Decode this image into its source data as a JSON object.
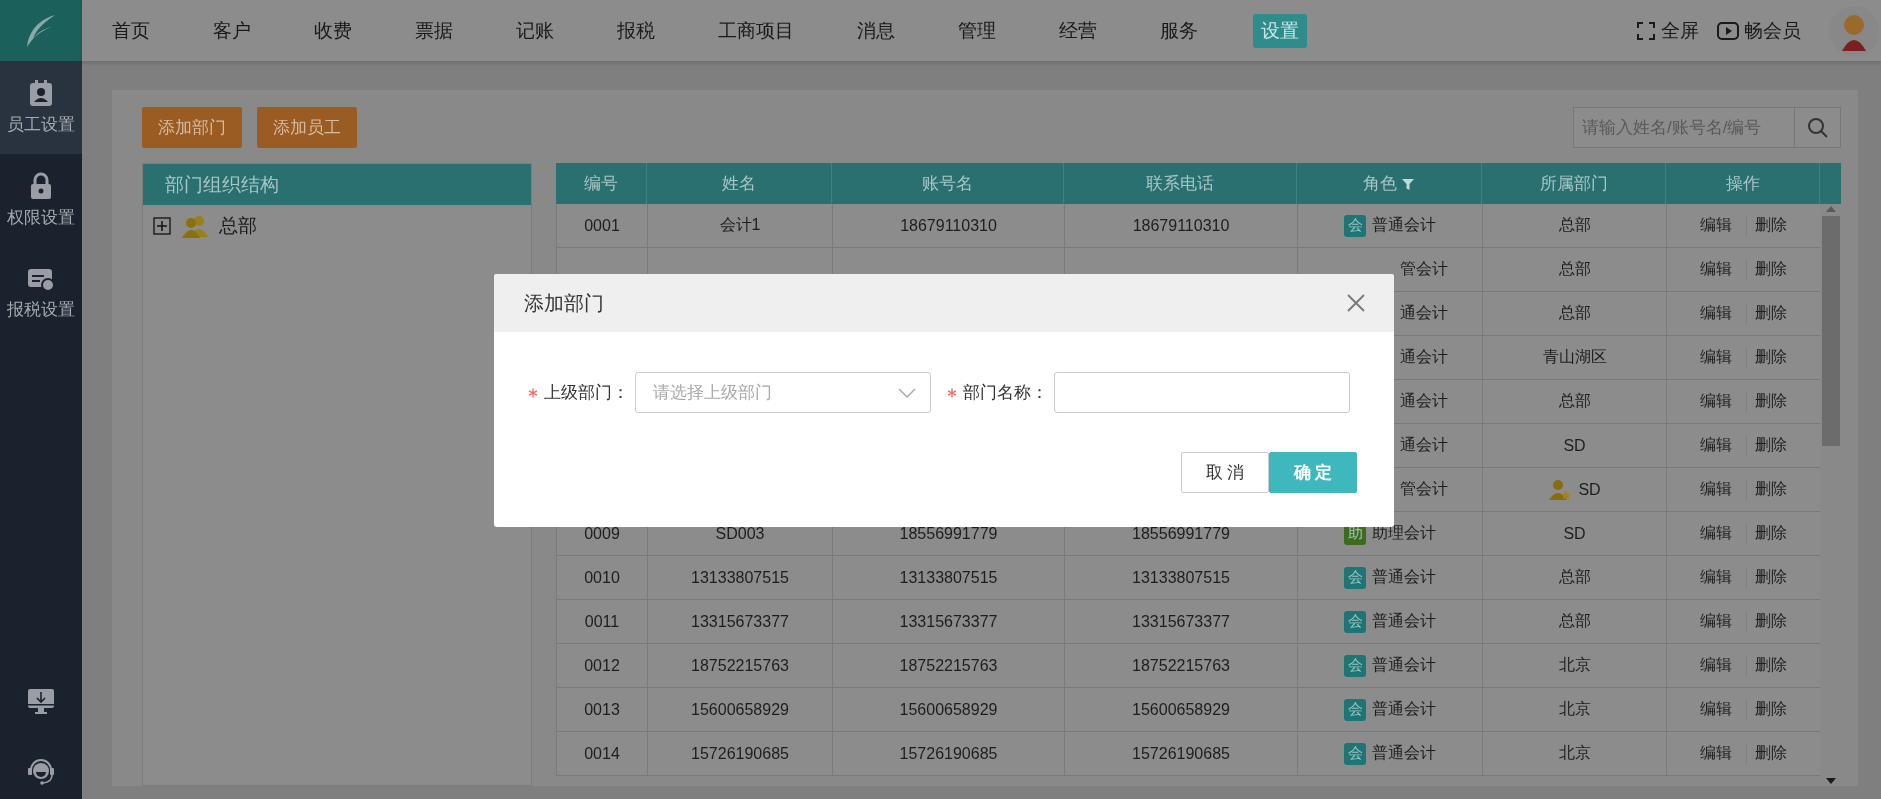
{
  "nav": [
    {
      "label": "首页",
      "selected": false
    },
    {
      "label": "客户",
      "selected": false
    },
    {
      "label": "收费",
      "selected": false
    },
    {
      "label": "票据",
      "selected": false
    },
    {
      "label": "记账",
      "selected": false
    },
    {
      "label": "报税",
      "selected": false
    },
    {
      "label": "工商项目",
      "selected": false
    },
    {
      "label": "消息",
      "selected": false
    },
    {
      "label": "管理",
      "selected": false
    },
    {
      "label": "经营",
      "selected": false
    },
    {
      "label": "服务",
      "selected": false
    },
    {
      "label": "设置",
      "selected": true
    }
  ],
  "top_actions": [
    {
      "label": "全屏",
      "kind": "fullscreen"
    },
    {
      "label": "畅会员",
      "kind": "member"
    }
  ],
  "sidebar": {
    "items": [
      {
        "label": "员工设置",
        "kind": "staff",
        "selected": true
      },
      {
        "label": "权限设置",
        "kind": "lock",
        "selected": false
      },
      {
        "label": "报税设置",
        "kind": "tax",
        "selected": false
      }
    ]
  },
  "toolbar": {
    "buttons": [
      "添加部门",
      "添加员工"
    ],
    "search": {
      "placeholder": "请输入姓名/账号名/编号"
    }
  },
  "tree": {
    "title": "部门组织结构",
    "nodes": [
      {
        "label": "总部",
        "expanded": false
      }
    ]
  },
  "table": {
    "columns": [
      {
        "label": "编号",
        "filter": false
      },
      {
        "label": "姓名",
        "filter": false
      },
      {
        "label": "账号名",
        "filter": false
      },
      {
        "label": "联系电话",
        "filter": false
      },
      {
        "label": "角色",
        "filter": true
      },
      {
        "label": "所属部门",
        "filter": false
      },
      {
        "label": "操作",
        "filter": false
      }
    ],
    "rows": [
      {
        "id": "0001",
        "name": "会计1",
        "account": "18679110310",
        "phone": "18679110310",
        "role": {
          "badge": "会",
          "text": "普通会计",
          "color": "#1f7575"
        },
        "dept": "总部",
        "manager": false,
        "actions": [
          "编辑",
          "删除"
        ]
      },
      {
        "role": {
          "text": "管会计"
        },
        "dept": "总部",
        "manager": false,
        "actions": [
          "编辑",
          "删除"
        ]
      },
      {
        "role": {
          "text": "通会计"
        },
        "dept": "总部",
        "manager": false,
        "actions": [
          "编辑",
          "删除"
        ]
      },
      {
        "role": {
          "text": "通会计"
        },
        "dept": "青山湖区",
        "manager": false,
        "actions": [
          "编辑",
          "删除"
        ]
      },
      {
        "role": {
          "text": "通会计"
        },
        "dept": "总部",
        "manager": false,
        "actions": [
          "编辑",
          "删除"
        ]
      },
      {
        "role": {
          "text": "通会计"
        },
        "dept": "SD",
        "manager": false,
        "actions": [
          "编辑",
          "删除"
        ]
      },
      {
        "role": {
          "text": "管会计"
        },
        "dept": "SD",
        "manager": true,
        "actions": [
          "编辑",
          "删除"
        ]
      },
      {
        "id": "0009",
        "name": "SD003",
        "account": "18556991779",
        "phone": "18556991779",
        "role": {
          "badge": "助",
          "text": "助理会计",
          "color": "#3d6a1c"
        },
        "dept": "SD",
        "manager": false,
        "actions": [
          "编辑",
          "删除"
        ]
      },
      {
        "id": "0010",
        "name": "13133807515",
        "account": "13133807515",
        "phone": "13133807515",
        "role": {
          "badge": "会",
          "text": "普通会计",
          "color": "#1f7575"
        },
        "dept": "总部",
        "manager": false,
        "actions": [
          "编辑",
          "删除"
        ]
      },
      {
        "id": "0011",
        "name": "13315673377",
        "account": "13315673377",
        "phone": "13315673377",
        "role": {
          "badge": "会",
          "text": "普通会计",
          "color": "#1f7575"
        },
        "dept": "总部",
        "manager": false,
        "actions": [
          "编辑",
          "删除"
        ]
      },
      {
        "id": "0012",
        "name": "18752215763",
        "account": "18752215763",
        "phone": "18752215763",
        "role": {
          "badge": "会",
          "text": "普通会计",
          "color": "#1f7575"
        },
        "dept": "北京",
        "manager": false,
        "actions": [
          "编辑",
          "删除"
        ]
      },
      {
        "id": "0013",
        "name": "15600658929",
        "account": "15600658929",
        "phone": "15600658929",
        "role": {
          "badge": "会",
          "text": "普通会计",
          "color": "#1f7575"
        },
        "dept": "北京",
        "manager": false,
        "actions": [
          "编辑",
          "删除"
        ]
      },
      {
        "id": "0014",
        "name": "15726190685",
        "account": "15726190685",
        "phone": "15726190685",
        "role": {
          "badge": "会",
          "text": "普通会计",
          "color": "#1f7575"
        },
        "dept": "北京",
        "manager": false,
        "actions": [
          "编辑",
          "删除"
        ]
      }
    ]
  },
  "dialog": {
    "title": "添加部门",
    "fields": [
      {
        "label": "上级部门：",
        "required": true,
        "kind": "select",
        "placeholder": "请选择上级部门"
      },
      {
        "label": "部门名称：",
        "required": true,
        "kind": "input"
      }
    ],
    "buttons": [
      {
        "label": "取 消",
        "kind": "secondary"
      },
      {
        "label": "确 定",
        "kind": "primary"
      }
    ]
  }
}
